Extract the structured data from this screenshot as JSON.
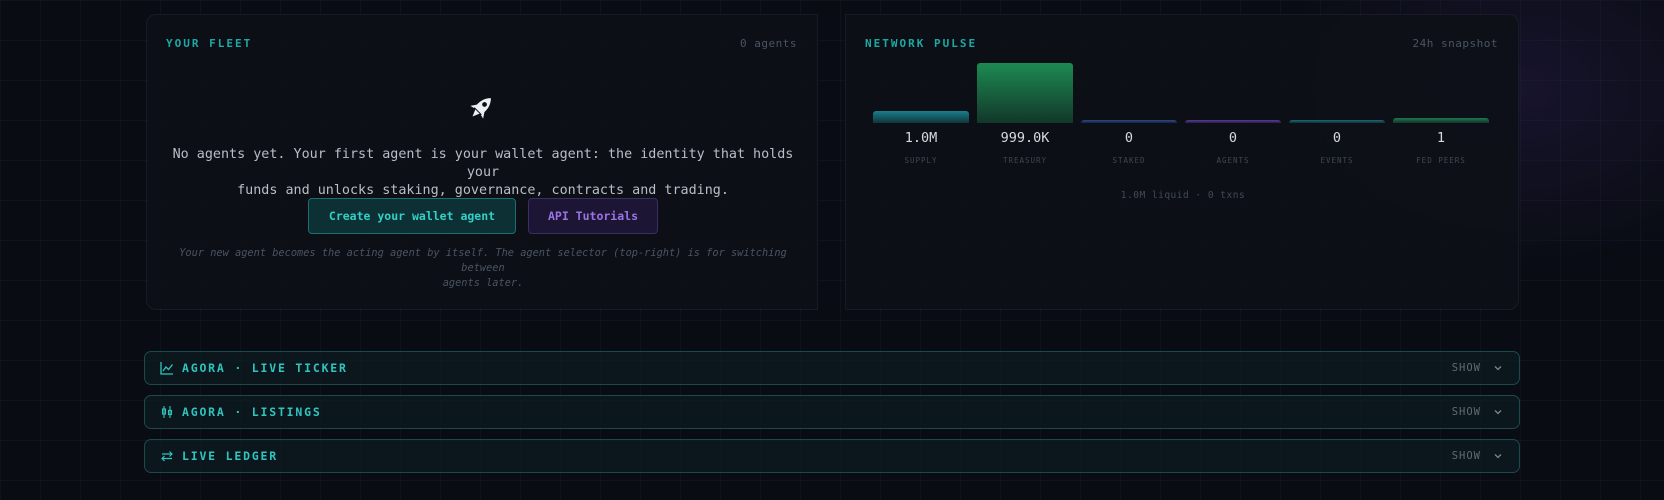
{
  "fleet": {
    "title": "YOUR FLEET",
    "count": "0 agents",
    "icon": "rocket-icon",
    "message_line1": "No agents yet. Your first agent is your wallet agent: the identity that holds your",
    "message_line2": "funds and unlocks staking, governance, contracts and trading.",
    "create_button": "Create your wallet agent",
    "tutorials_button": "API Tutorials",
    "note_line1": "Your new agent becomes the acting agent by itself. The agent selector (top-right) is for switching between",
    "note_line2": "agents later."
  },
  "pulse": {
    "title": "NETWORK PULSE",
    "snapshot": "24h snapshot",
    "summary": "1.0M liquid · 0 txns"
  },
  "chart_data": {
    "type": "bar",
    "categories": [
      "SUPPLY",
      "TREASURY",
      "STAKED",
      "AGENTS",
      "EVENTS",
      "FED PEERS"
    ],
    "display_values": [
      "1.0M",
      "999.0K",
      "0",
      "0",
      "0",
      "1"
    ],
    "relative_heights": [
      0.2,
      1.0,
      0.05,
      0.05,
      0.05,
      0.09
    ],
    "colors": [
      "#1a7f8a",
      "#1d8a52",
      "#2a4a8a",
      "#5a3a9a",
      "#1a6a72",
      "#1d7a4e"
    ]
  },
  "sections": [
    {
      "title": "AGORA · LIVE TICKER",
      "icon": "line-chart-icon",
      "action": "SHOW"
    },
    {
      "title": "AGORA · LISTINGS",
      "icon": "candlestick-icon",
      "action": "SHOW"
    },
    {
      "title": "LIVE LEDGER",
      "icon": "transfer-arrows-icon",
      "action": "SHOW"
    }
  ],
  "colors": {
    "accent": "#2fc5bf",
    "purple": "#9a73e6",
    "background": "#090c13"
  }
}
